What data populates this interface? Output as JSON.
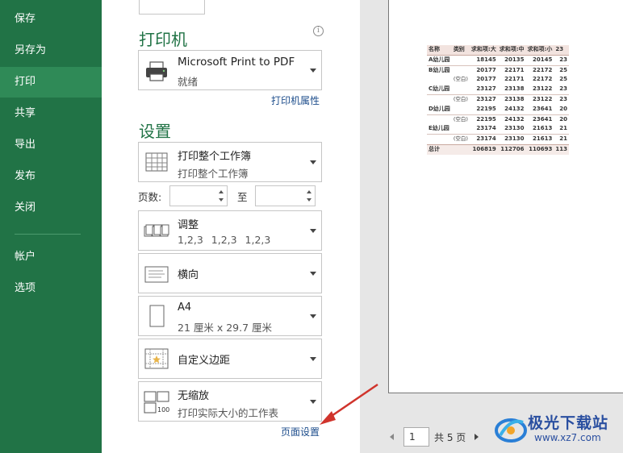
{
  "nav": {
    "items": [
      {
        "label": "保存",
        "active": false
      },
      {
        "label": "另存为",
        "active": false
      },
      {
        "label": "打印",
        "active": true
      },
      {
        "label": "共享",
        "active": false
      },
      {
        "label": "导出",
        "active": false
      },
      {
        "label": "发布",
        "active": false
      },
      {
        "label": "关闭",
        "active": false
      }
    ],
    "bottom_items": [
      {
        "label": "帐户"
      },
      {
        "label": "选项"
      }
    ]
  },
  "printer": {
    "section_title": "打印机",
    "name": "Microsoft Print to PDF",
    "status": "就绪",
    "properties_link": "打印机属性",
    "info_icon": "info-icon"
  },
  "settings": {
    "section_title": "设置",
    "scope": {
      "main": "打印整个工作簿",
      "sub": "打印整个工作簿"
    },
    "pages": {
      "label": "页数:",
      "to_label": "至",
      "from_value": "",
      "to_value": ""
    },
    "collate": {
      "main": "调整",
      "sub": "1,2,3    1,2,3    1,2,3"
    },
    "orientation": {
      "main": "横向"
    },
    "paper": {
      "main": "A4",
      "sub": "21 厘米 x 29.7 厘米"
    },
    "margins": {
      "main": "自定义边距"
    },
    "scaling": {
      "main": "无缩放",
      "sub": "打印实际大小的工作表"
    },
    "page_setup_link": "页面设置"
  },
  "preview": {
    "table": {
      "headers": [
        "名称",
        "类别",
        "求和项:大",
        "求和项:中",
        "求和项:小",
        "23"
      ],
      "rows": [
        {
          "name": "A幼儿园",
          "cat": "",
          "v": [
            "18145",
            "20135",
            "20145",
            "23"
          ],
          "sep": true
        },
        {
          "name": "B幼儿园",
          "cat": "",
          "v": [
            "20177",
            "22171",
            "22172",
            "25"
          ],
          "sep": true
        },
        {
          "name": "",
          "cat": "(空白)",
          "v": [
            "20177",
            "22171",
            "22172",
            "25"
          ],
          "sep": false
        },
        {
          "name": "C幼儿园",
          "cat": "",
          "v": [
            "23127",
            "23138",
            "23122",
            "23"
          ],
          "sep": false
        },
        {
          "name": "",
          "cat": "(空白)",
          "v": [
            "23127",
            "23138",
            "23122",
            "23"
          ],
          "sep": true
        },
        {
          "name": "D幼儿园",
          "cat": "",
          "v": [
            "22195",
            "24132",
            "23641",
            "20"
          ],
          "sep": false
        },
        {
          "name": "",
          "cat": "(空白)",
          "v": [
            "22195",
            "24132",
            "23641",
            "20"
          ],
          "sep": true
        },
        {
          "name": "E幼儿园",
          "cat": "",
          "v": [
            "23174",
            "23130",
            "21613",
            "21"
          ],
          "sep": false
        },
        {
          "name": "",
          "cat": "(空白)",
          "v": [
            "23174",
            "23130",
            "21613",
            "21"
          ],
          "sep": true
        }
      ],
      "total": {
        "name": "总计",
        "v": [
          "106819",
          "112706",
          "110693",
          "113"
        ]
      }
    },
    "pager": {
      "current": "1",
      "total_label": "共 5 页"
    }
  },
  "watermark": {
    "name": "极光下载站",
    "url": "www.xz7.com"
  },
  "colors": {
    "nav_bg": "#217346",
    "nav_active": "#2f8a57",
    "accent": "#217346",
    "link": "#1e4e8c",
    "arrow": "#d0342c"
  }
}
